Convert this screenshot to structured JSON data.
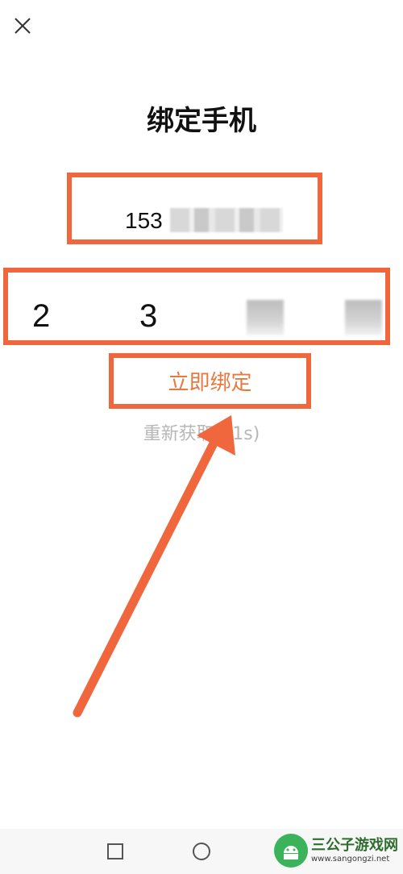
{
  "header": {
    "close_icon": "close-icon"
  },
  "title": "绑定手机",
  "phone": {
    "visible_prefix": "153"
  },
  "code": {
    "digits": [
      "2",
      "3"
    ]
  },
  "bind_button_label": "立即绑定",
  "resend_label": "重新获取(51s)",
  "colors": {
    "highlight": "#f0673d",
    "accent_text": "#e8793e",
    "muted_text": "#b7b7b7"
  },
  "navbar": {
    "icons": [
      "square-icon",
      "circle-icon",
      "back-triangle-icon"
    ]
  },
  "watermark": {
    "name": "三公子游戏网",
    "url": "www.sangongzi.net"
  }
}
